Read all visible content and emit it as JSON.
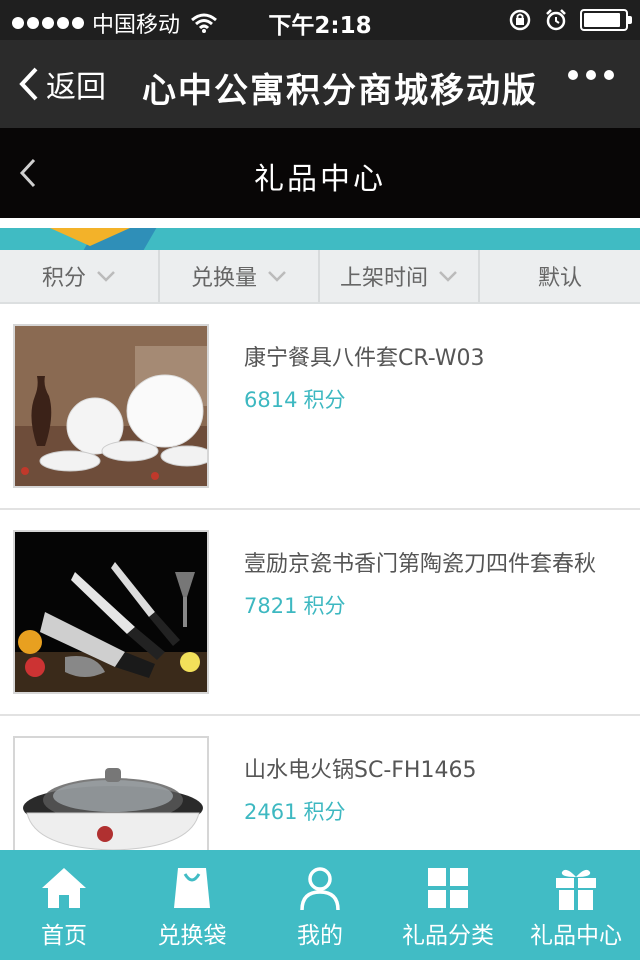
{
  "status_bar": {
    "carrier": "中国移动",
    "time": "下午2:18",
    "battery_level": 0.9
  },
  "wechat_nav": {
    "back_label": "返回",
    "title": "心中公寓积分商城移动版"
  },
  "page_header": {
    "title": "礼品中心"
  },
  "sort_bar": {
    "items": [
      {
        "label": "积分"
      },
      {
        "label": "兑换量"
      },
      {
        "label": "上架时间"
      },
      {
        "label": "默认"
      }
    ]
  },
  "products": [
    {
      "name": "康宁餐具八件套CR-W03",
      "points": "6814",
      "unit": "积分",
      "image": "dinnerware-set-photo"
    },
    {
      "name": "壹励京瓷书香门第陶瓷刀四件套春秋",
      "points": "7821",
      "unit": "积分",
      "image": "ceramic-knife-set-photo"
    },
    {
      "name": "山水电火锅SC-FH1465",
      "points": "2461",
      "unit": "积分",
      "image": "electric-hotpot-photo"
    }
  ],
  "tab_bar": {
    "items": [
      {
        "label": "首页",
        "icon": "home-icon"
      },
      {
        "label": "兑换袋",
        "icon": "shopping-bag-icon"
      },
      {
        "label": "我的",
        "icon": "user-icon"
      },
      {
        "label": "礼品分类",
        "icon": "grid-icon"
      },
      {
        "label": "礼品中心",
        "icon": "gift-icon"
      }
    ]
  },
  "colors": {
    "accent": "#41bcc5",
    "price": "#3db8c1",
    "header_bg": "#080606",
    "nav_bg": "#2b2b2b"
  }
}
